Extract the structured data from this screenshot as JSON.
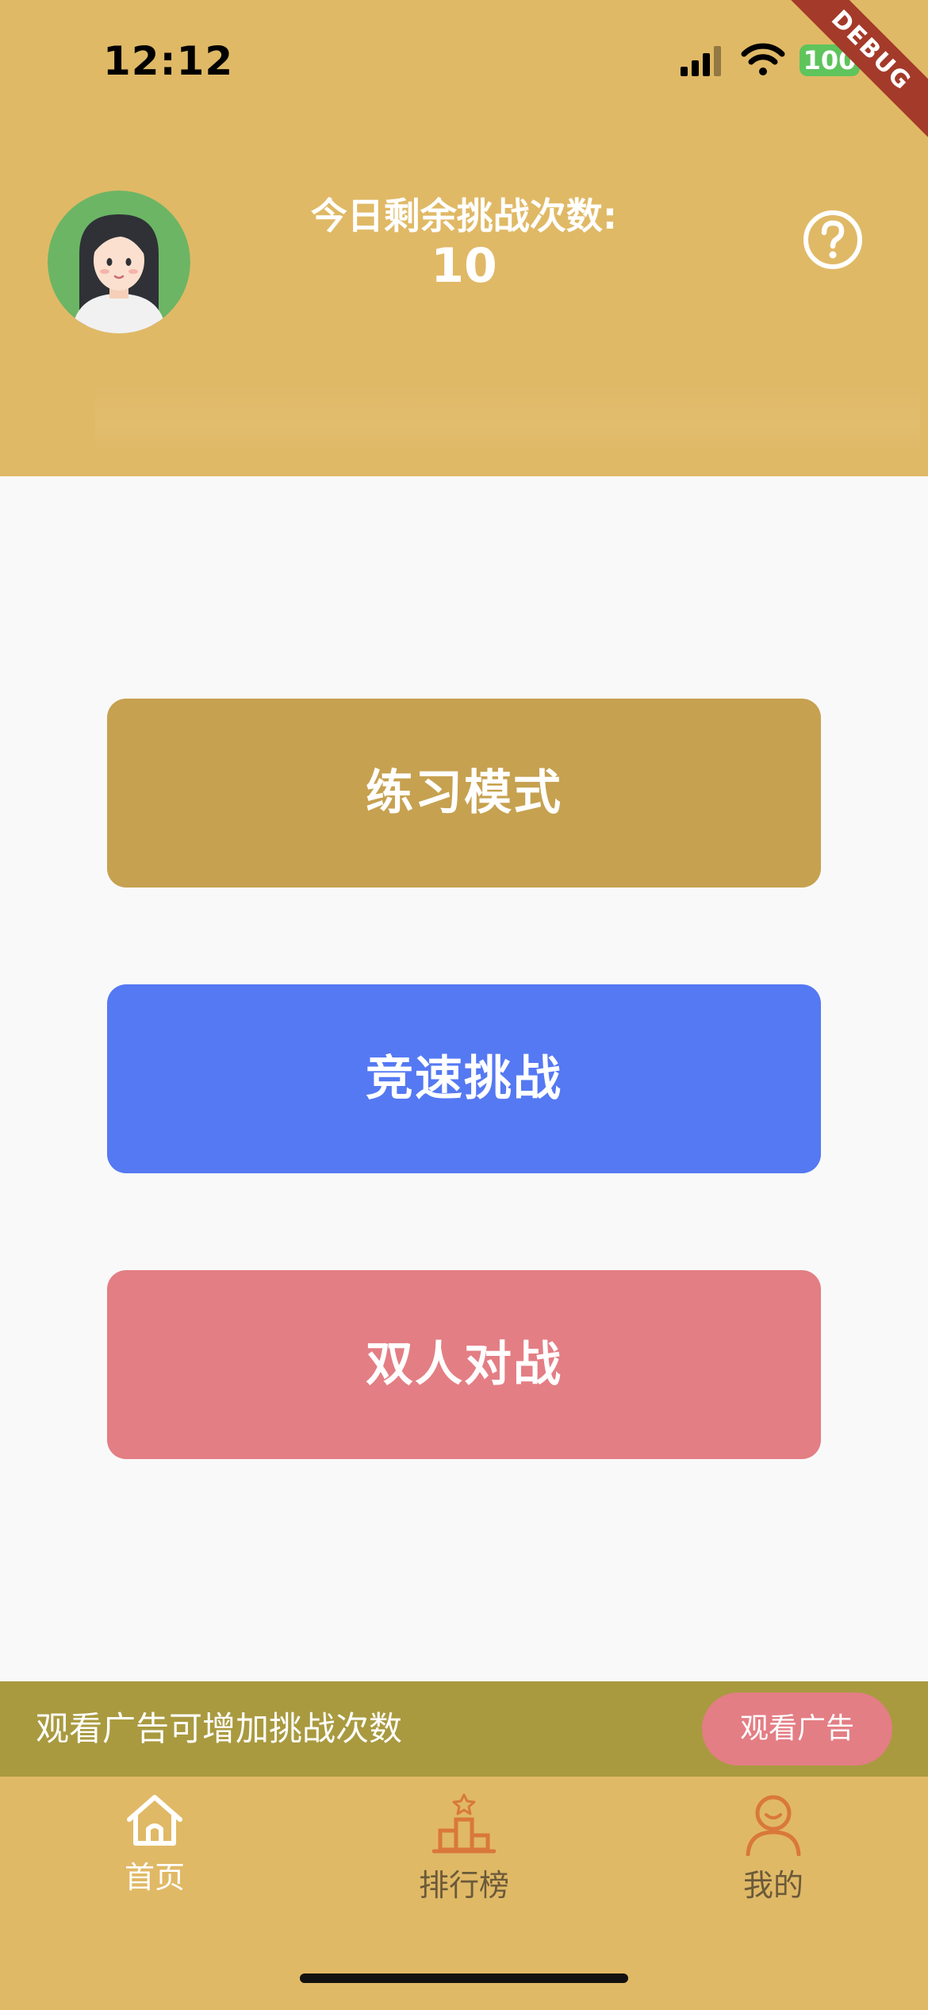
{
  "status_bar": {
    "time": "12:12",
    "battery": "100"
  },
  "debug_banner": "DEBUG",
  "header": {
    "challenge_label": "今日剩余挑战次数:",
    "challenge_count": "10"
  },
  "modes": {
    "practice": "练习模式",
    "speed": "竞速挑战",
    "duel": "双人对战"
  },
  "ad": {
    "text": "观看广告可增加挑战次数",
    "button": "观看广告"
  },
  "nav": {
    "home": "首页",
    "ranking": "排行榜",
    "mine": "我的"
  },
  "colors": {
    "header_bg": "#e0b966",
    "practice": "#c6a150",
    "speed": "#5579f2",
    "duel": "#e37e84",
    "ad_bar": "#a99a40",
    "nav_icon_active": "#ffffff",
    "nav_icon_inactive": "#d9783a"
  },
  "icons": {
    "signal": "signal-icon",
    "wifi": "wifi-icon",
    "help": "help-icon",
    "home": "home-icon",
    "ranking": "ranking-icon",
    "mine": "person-icon"
  }
}
